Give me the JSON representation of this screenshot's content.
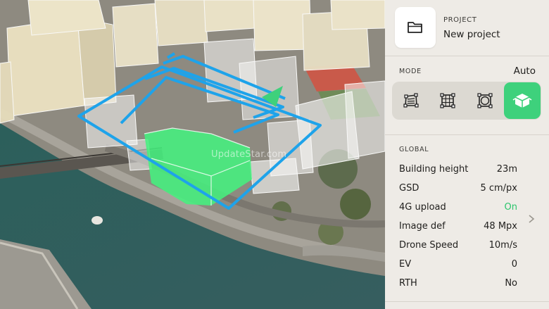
{
  "project": {
    "caption": "PROJECT",
    "name": "New project",
    "icon": "folder-icon"
  },
  "mode": {
    "caption": "MODE",
    "value": "Auto",
    "buttons": [
      {
        "icon": "polygon-mode-icon",
        "active": false
      },
      {
        "icon": "grid-mode-icon",
        "active": false
      },
      {
        "icon": "orbit-mode-icon",
        "active": false
      },
      {
        "icon": "3d-building-mode-icon",
        "active": true
      }
    ]
  },
  "global": {
    "caption": "GLOBAL",
    "settings": [
      {
        "label": "Building height",
        "value": "23m"
      },
      {
        "label": "GSD",
        "value": "5 cm/px"
      },
      {
        "label": "4G upload",
        "value": "On"
      },
      {
        "label": "Image def",
        "value": "48 Mpx"
      },
      {
        "label": "Drone Speed",
        "value": "10m/s"
      },
      {
        "label": "EV",
        "value": "0"
      },
      {
        "label": "RTH",
        "value": "No"
      }
    ]
  },
  "map": {
    "watermark": "UpdateStar.com"
  },
  "colors": {
    "accent": "#3ed17c",
    "flight_path": "#1ea3ea",
    "panel_bg": "#eeebe6",
    "water": "#2f5f5c"
  }
}
